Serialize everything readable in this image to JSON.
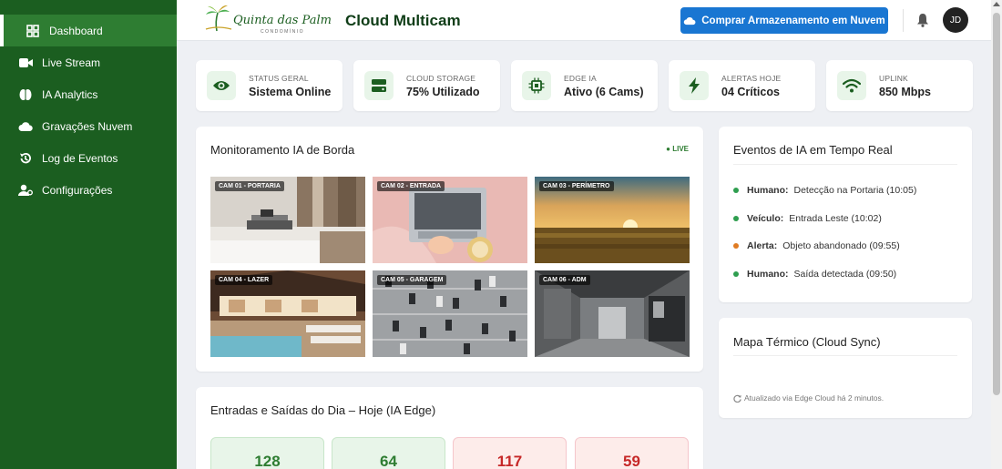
{
  "sidebar": {
    "items": [
      {
        "label": "Dashboard",
        "icon": "grid-icon"
      },
      {
        "label": "Live Stream",
        "icon": "video-camera-icon"
      },
      {
        "label": "IA Analytics",
        "icon": "brain-icon"
      },
      {
        "label": "Gravações Nuvem",
        "icon": "cloud-icon"
      },
      {
        "label": "Log de Eventos",
        "icon": "history-icon"
      },
      {
        "label": "Configurações",
        "icon": "users-cog-icon"
      }
    ]
  },
  "header": {
    "logo_text": "Quinta das Palmares",
    "logo_subtext": "CONDOMÍNIO",
    "title": "Cloud Multicam",
    "cta_label": "Comprar Armazenamento em Nuvem",
    "avatar_initials": "JD"
  },
  "stats": [
    {
      "label": "Status Geral",
      "value": "Sistema Online",
      "icon": "eye-icon"
    },
    {
      "label": "Cloud Storage",
      "value": "75% Utilizado",
      "icon": "server-icon"
    },
    {
      "label": "Edge IA",
      "value": "Ativo (6 Cams)",
      "icon": "chip-icon"
    },
    {
      "label": "Alertas Hoje",
      "value": "04 Críticos",
      "icon": "lightning-icon"
    },
    {
      "label": "Uplink",
      "value": "850 Mbps",
      "icon": "wifi-icon"
    }
  ],
  "monitor": {
    "title": "Monitoramento IA de Borda",
    "live_label": "● LIVE",
    "cameras": [
      {
        "label": "CAM 01 - PORTARIA"
      },
      {
        "label": "CAM 02 - ENTRADA"
      },
      {
        "label": "CAM 03 - PERÍMETRO"
      },
      {
        "label": "CAM 04 - LAZER"
      },
      {
        "label": "CAM 05 - GARAGEM"
      },
      {
        "label": "CAM 06 - ADM"
      }
    ]
  },
  "events": {
    "title": "Eventos de IA em Tempo Real",
    "items": [
      {
        "type": "Humano:",
        "text": "Detecção na Portaria (10:05)",
        "color": "#2e9e4f"
      },
      {
        "type": "Veículo:",
        "text": "Entrada Leste (10:02)",
        "color": "#2e9e4f"
      },
      {
        "type": "Alerta:",
        "text": "Objeto abandonado (09:55)",
        "color": "#e07b22"
      },
      {
        "type": "Humano:",
        "text": "Saída detectada (09:50)",
        "color": "#2e9e4f"
      }
    ]
  },
  "heatmap": {
    "title": "Mapa Térmico (Cloud Sync)",
    "updated": "Atualizado via Edge Cloud há 2 minutos."
  },
  "traffic": {
    "title": "Entradas e Saídas do Dia – Hoje (IA Edge)",
    "counts": [
      {
        "value": "128",
        "tone": "green"
      },
      {
        "value": "64",
        "tone": "green"
      },
      {
        "value": "117",
        "tone": "red"
      },
      {
        "value": "59",
        "tone": "red"
      }
    ]
  },
  "colors": {
    "sidebar": "#1b5e20",
    "accent_blue": "#1976d2",
    "title_green": "#0f3d17"
  }
}
